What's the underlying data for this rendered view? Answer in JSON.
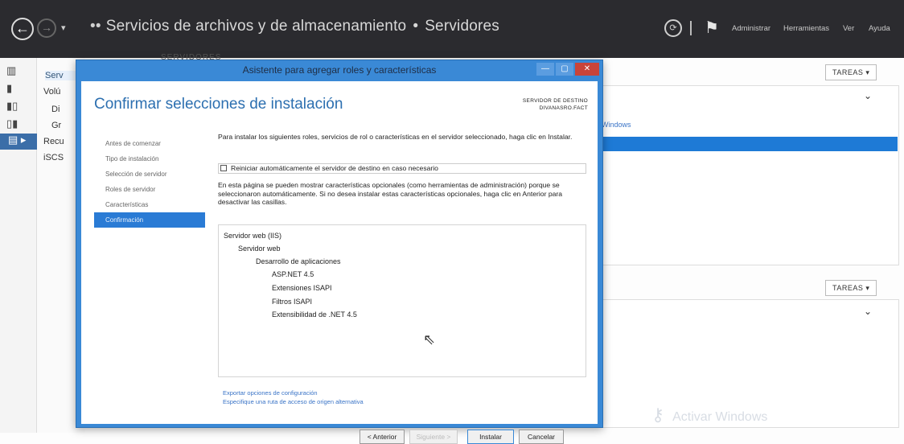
{
  "topbar": {
    "back_icon": "←",
    "forward_icon": "→",
    "dropdown_icon": "▾",
    "dots": "••",
    "crumb_part1": "Servicios de archivos y de almacenamiento",
    "crumb_separator": "•",
    "crumb_part2": "Servidores",
    "refresh_icon": "⟳",
    "flag_icon": "⚑",
    "menu": [
      "Administrar",
      "Herramientas",
      "Ver",
      "Ayuda"
    ]
  },
  "rail": {
    "icons": [
      "▥",
      "▮",
      "▮▯",
      "▯▮",
      "▤ ▸"
    ]
  },
  "server_pane": {
    "items": [
      "Serv",
      "Volú",
      "Di",
      "Gr",
      "Recu",
      "iSCS"
    ],
    "header": "SERVIDORES",
    "tasks_label": "TAREAS ▾",
    "tasks_label_2": "TAREAS ▾",
    "chevron": "⌄",
    "link_text": "Windows",
    "activate_text": "Activar Windows",
    "key_icon": "⚷"
  },
  "dialog": {
    "title": "Asistente para agregar roles y características",
    "min_label": "—",
    "max_label": "▢",
    "close_label": "✕",
    "heading": "Confirmar selecciones de instalación",
    "dest_label": "SERVIDOR DE DESTINO",
    "dest_server": "DIVANASRO.FACT",
    "steps": [
      "Antes de comenzar",
      "Tipo de instalación",
      "Selección de servidor",
      "Roles de servidor",
      "Características",
      "Confirmación"
    ],
    "intro": "Para instalar los siguientes roles, servicios de rol o características en el servidor seleccionado, haga clic en Instalar.",
    "checkbox_label": "Reiniciar automáticamente el servidor de destino en caso necesario",
    "para2": "En esta página se pueden mostrar características opcionales (como herramientas de administración) porque se seleccionaron automáticamente. Si no desea instalar estas características opcionales, haga clic en Anterior para desactivar las casillas.",
    "selections": [
      "Servidor web (IIS)",
      "Servidor web",
      "Desarrollo de aplicaciones",
      "ASP.NET 4.5",
      "Extensiones ISAPI",
      "Filtros ISAPI",
      "Extensibilidad de .NET 4.5"
    ],
    "cursor_icon": "⇖",
    "link_export": "Exportar opciones de configuración",
    "link_alt_source": "Especifique una ruta de acceso de origen alternativa",
    "btn_prev": "< Anterior",
    "btn_next": "Siguiente >",
    "btn_install": "Instalar",
    "btn_cancel": "Cancelar"
  }
}
